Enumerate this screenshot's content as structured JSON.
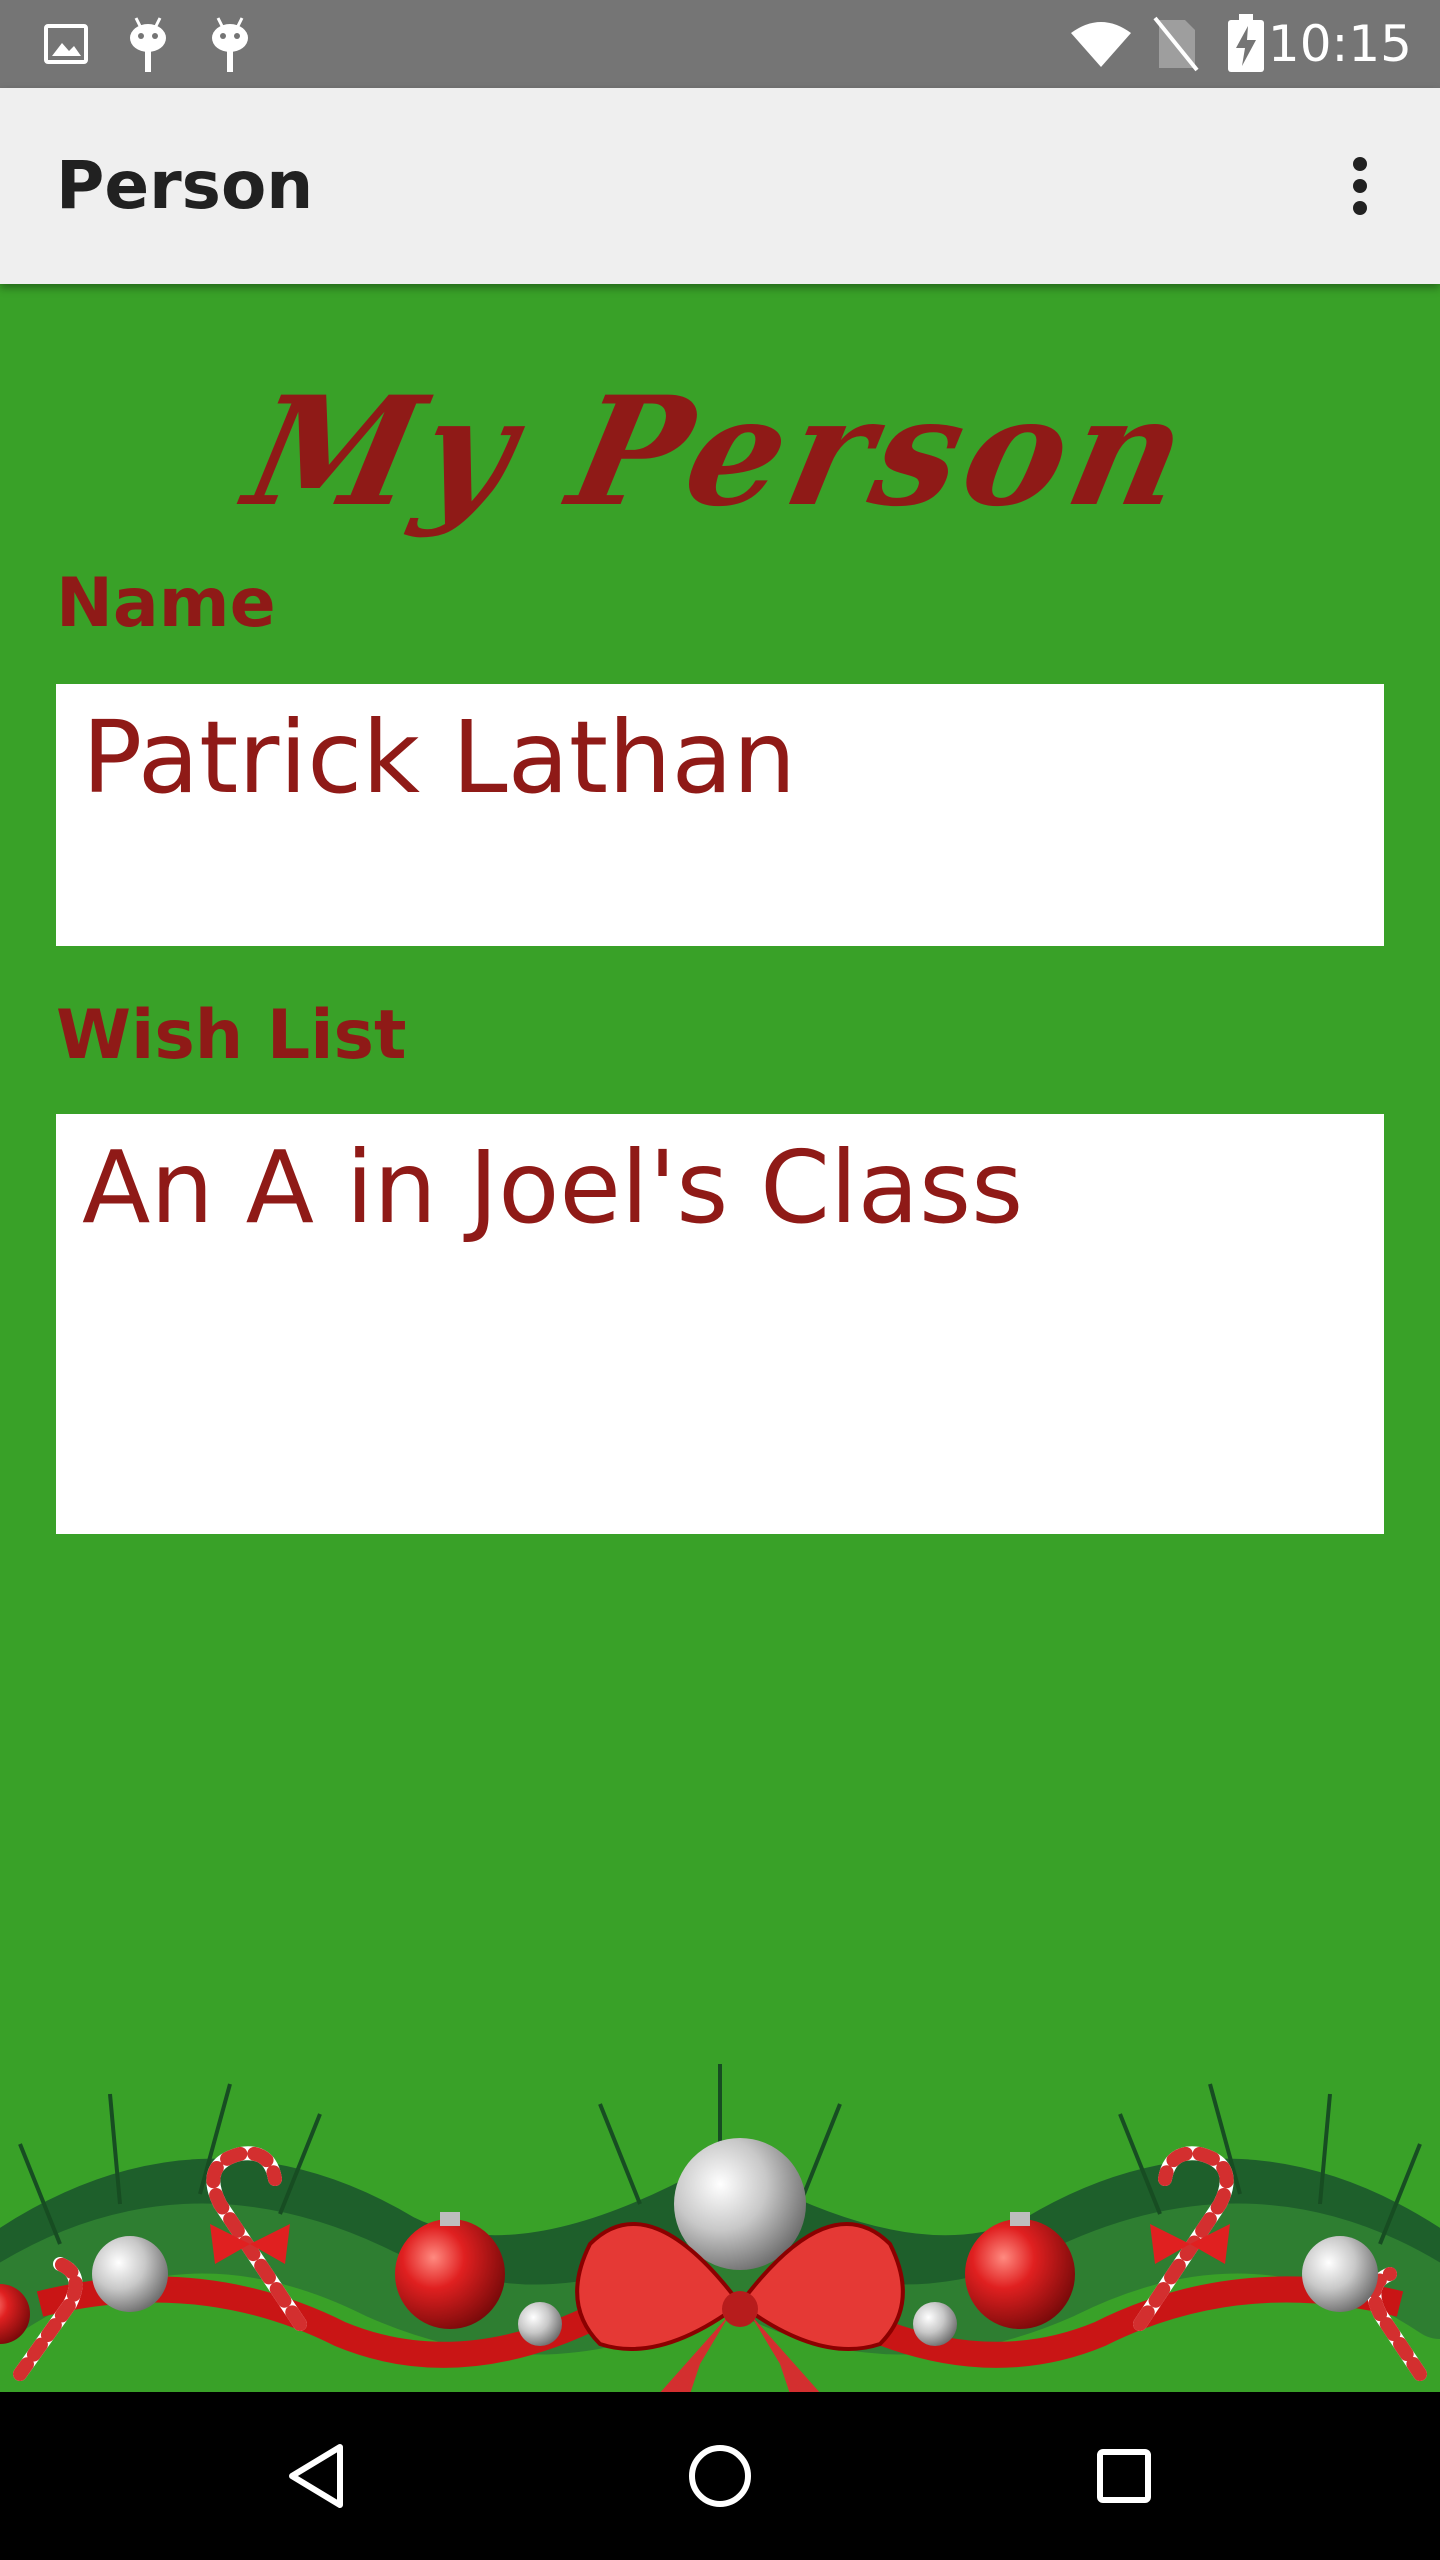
{
  "status_bar": {
    "time": "10:15",
    "left_icons": [
      "image-icon",
      "android-icon",
      "android-icon"
    ],
    "right_icons": [
      "wifi-icon",
      "no-sim-icon",
      "battery-charging-icon"
    ]
  },
  "app_bar": {
    "title": "Person",
    "overflow_icon": "more-vert-icon"
  },
  "content": {
    "header_title": "My Person",
    "name_label": "Name",
    "name_value": "Patrick Lathan",
    "wishlist_label": "Wish List",
    "wishlist_value": "An A in Joel's Class"
  },
  "colors": {
    "background_green": "#39a128",
    "text_red": "#8f1a17",
    "status_bar": "#757575",
    "app_bar": "#efefef"
  },
  "nav_bar": {
    "icons": [
      "back-icon",
      "home-icon",
      "recents-icon"
    ]
  }
}
